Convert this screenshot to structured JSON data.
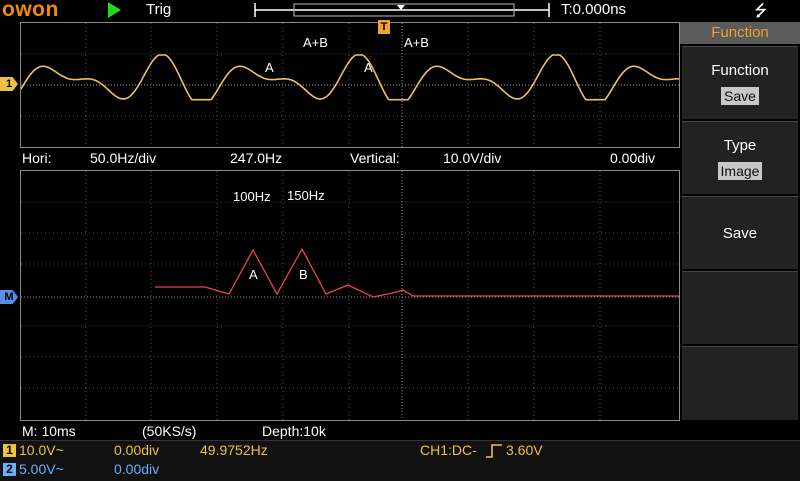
{
  "topbar": {
    "logo": "owon",
    "run_state_icon": "play-icon",
    "trigger_label": "Trig",
    "time_offset": "T:0.000ns",
    "usb_icon": "usb-icon",
    "trigger_marker": "T"
  },
  "upper_window": {
    "channel_marker": "1",
    "labels": [
      "A+B",
      "A+B",
      "A",
      "A"
    ],
    "waveform_color": "#f0c060"
  },
  "status_mid": {
    "hori_label": "Hori:",
    "hori_scale": "50.0Hz/div",
    "center_freq": "247.0Hz",
    "vertical_label": "Vertical:",
    "vertical_scale": "10.0V/div",
    "offset": "0.00div"
  },
  "lower_window": {
    "channel_marker": "M",
    "freq_labels": [
      "100Hz",
      "150Hz"
    ],
    "peak_labels": [
      "A",
      "B"
    ],
    "waveform_color": "#e04a4a"
  },
  "status_bottom": {
    "timebase": "M: 10ms",
    "sample_rate": "(50KS/s)",
    "depth": "Depth:10k"
  },
  "side_menu": {
    "title": "Function",
    "items": [
      {
        "label": "Function",
        "value": "Save"
      },
      {
        "label": "Type",
        "value": "Image"
      },
      {
        "label": "Save",
        "value": ""
      }
    ]
  },
  "footer": {
    "ch1": {
      "num": "1",
      "scale": "10.0V~",
      "offset": "0.00div",
      "freq": "49.9752Hz",
      "trigger": "CH1:DC-",
      "level": "3.60V",
      "color": "#f0c040"
    },
    "ch2": {
      "num": "2",
      "scale": "5.00V~",
      "offset": "0.00div",
      "color": "#6aaeff"
    }
  }
}
